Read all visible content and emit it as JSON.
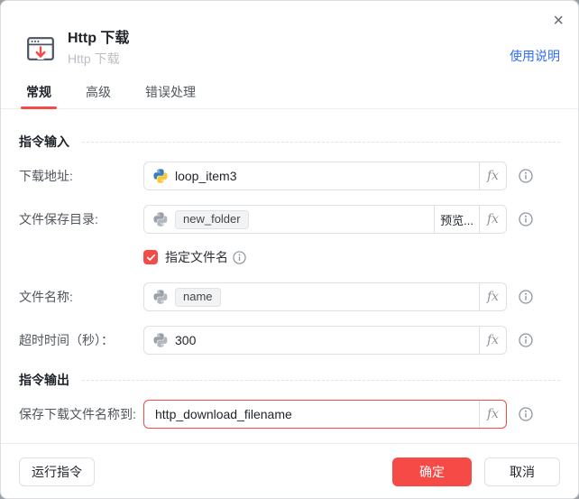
{
  "window": {
    "close_glyph": "×"
  },
  "header": {
    "title": "Http 下载",
    "subtitle": "Http 下载",
    "help_link": "使用说明",
    "icon": "http-download-window-icon"
  },
  "tabs": {
    "general": "常规",
    "advanced": "高级",
    "error_handling": "错误处理",
    "active_tab": "常规"
  },
  "sections": {
    "input_title": "指令输入",
    "output_title": "指令输出"
  },
  "form": {
    "download_url": {
      "label": "下载地址:",
      "value": "loop_item3",
      "icon": "python-icon-colored"
    },
    "save_dir": {
      "label": "文件保存目录:",
      "value": "new_folder",
      "value_style": "chip",
      "preview_button": "预览...",
      "icon": "python-icon-gray"
    },
    "specify_filename": {
      "label": "指定文件名",
      "checked": true
    },
    "file_name": {
      "label": "文件名称:",
      "value": "name",
      "value_style": "chip",
      "icon": "python-icon-gray"
    },
    "timeout": {
      "label": "超时时间（秒）：",
      "value": "300",
      "icon": "python-icon-gray"
    },
    "output_var": {
      "label": "保存下载文件名称到:",
      "value": "http_download_filename",
      "state": "error-highlight"
    }
  },
  "fx_label": "fx",
  "footer": {
    "run_button": "运行指令",
    "ok_button": "确定",
    "cancel_button": "取消"
  },
  "colors": {
    "accent_red": "#f54a45",
    "link_blue": "#336df4",
    "text_dark": "#1f2329",
    "label_gray": "#51565d",
    "border_gray": "#dee0e3"
  }
}
